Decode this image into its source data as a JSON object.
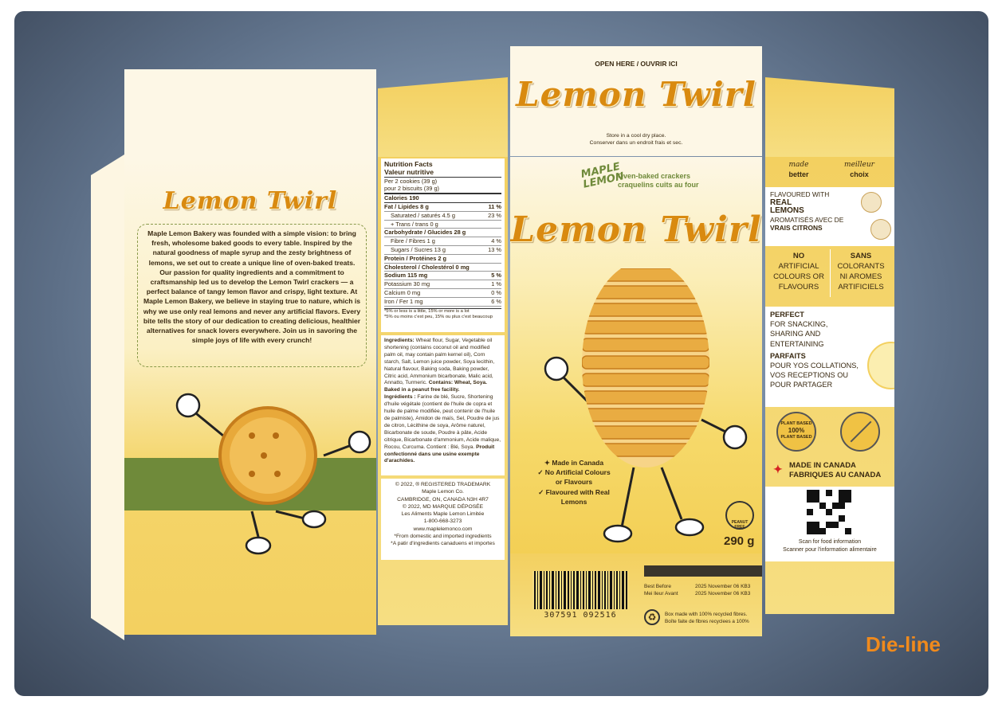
{
  "product_name": "Lemon Twirl",
  "back_panel": {
    "story": "Maple Lemon Bakery was founded with a simple vision: to bring fresh, wholesome baked goods to every table. Inspired by the natural goodness of maple syrup and the zesty brightness of lemons, we set out to create a unique line of oven-baked treats. Our passion for quality ingredients and a commitment to craftsmanship led us to develop the Lemon Twirl crackers — a perfect balance of tangy lemon flavor and crispy, light texture. At Maple Lemon Bakery, we believe in staying true to nature, which is why we use only real lemons and never any artificial flavors. Every bite tells the story of our dedication to creating delicious, healthier alternatives for snack lovers everywhere. Join us in savoring the simple joys of life with every crunch!"
  },
  "nutrition": {
    "title_en": "Nutrition Facts",
    "title_fr": "Valeur nutritive",
    "serving_en": "Per 2 cookies (39 g)",
    "serving_fr": "pour 2 biscuits (39 g)",
    "calories": "Calories 190",
    "rows": [
      {
        "label": "Fat / Lipides 8 g",
        "dv": "11 %",
        "bold": true
      },
      {
        "label": "Saturated / saturés 4.5 g",
        "dv": "23 %",
        "indent": true
      },
      {
        "label": "+ Trans / trans 0 g",
        "dv": "",
        "indent": true
      },
      {
        "label": "Carbohydrate / Glucides 28 g",
        "dv": "",
        "bold": true
      },
      {
        "label": "Fibre / Fibres 1 g",
        "dv": "4 %",
        "indent": true
      },
      {
        "label": "Sugars / Sucres 13 g",
        "dv": "13 %",
        "indent": true
      },
      {
        "label": "Protein / Protéines 2 g",
        "dv": "",
        "bold": true
      },
      {
        "label": "Cholesterol / Cholestérol 0 mg",
        "dv": "",
        "bold": true
      },
      {
        "label": "Sodium 115 mg",
        "dv": "5 %",
        "bold": true
      },
      {
        "label": "Potassium 30 mg",
        "dv": "1 %"
      },
      {
        "label": "Calcium 0 mg",
        "dv": "0 %"
      },
      {
        "label": "Iron / Fer 1 mg",
        "dv": "6 %"
      }
    ],
    "footnote_en": "*5% or less is a little, 15% or more is a lot",
    "footnote_fr": "*5% ou moins c'est peu, 15% ou plus c'est beaucoup"
  },
  "ingredients": {
    "en_label": "Ingredients:",
    "en": "Wheat flour, Sugar, Vegetable oil shortening (contains coconut oil and modified palm oil, may contain palm kernel oil), Corn starch, Salt, Lemon juice powder, Soya lecithin, Natural flavour, Baking soda, Baking powder, Citric acid, Ammonium bicarbonate, Malic acid, Annatto, Turmeric.",
    "en_contains": "Contains: Wheat, Soya.",
    "peanut_free": "Baked in a peanut free facility.",
    "fr_label": "Ingrédients :",
    "fr": "Farine de blé, Sucre, Shortening d'huile végétale (contient de l'huile de copra et huile de palme modifiée, peut contenir de l'huile de palmiste), Amidon de maïs, Sel, Poudre de jus de citron, Lécithine de soya, Arôme naturel, Bicarbonate de soude, Poudre à pâte, Acide citrique, Bicarbonate d'ammonium, Acide malique, Rocou, Curcuma.",
    "fr_contains": "Contient : Blé, Soya.",
    "fr_peanut": "Produit confectionné dans une usine exempte d'arachides."
  },
  "company": {
    "lines": [
      "© 2022, ® REGISTERED TRADEMARK",
      "Maple Lemon Co.",
      "CAMBRIDGE, ON, CANADA N3H 4R7",
      "© 2022, MD MARQUE DÉPOSÉE",
      "Les Aliments Maple Lemon Limitée",
      "1-800-668-3273",
      "www.maplelemonco.com",
      "*From domestic and imported ingredients",
      "*A patir d'ingredients canaduens et importes"
    ]
  },
  "front_top": {
    "open_here": "OPEN HERE / OUVRIR ICI",
    "storage_en": "Store in a cool dry place.",
    "storage_fr": "Conserver dans un endroit frais et sec."
  },
  "front": {
    "brand_line1": "MAPLE",
    "brand_line2": "LEMON",
    "tagline_en": "Oven-baked crackers",
    "tagline_fr": "craquelins cuits au four",
    "claims": [
      "Made in Canada",
      "No Artificial Colours",
      "or Flavours",
      "Flavoured with Real",
      "Lemons"
    ],
    "peanut_badge": "PEANUT FREE",
    "weight": "290 g"
  },
  "bottom_flap": {
    "best_before_en": "Best Before",
    "best_before_fr": "Mei lleur Avant",
    "date1": "2025 November 06 KB3",
    "date2": "2025 November 06 KB3",
    "barcode_number": "307591 092516",
    "recycle_en": "Box made with 100% recycled fibres.",
    "recycle_fr": "Boîte faite de fibres recyclees a 100%"
  },
  "side": {
    "made_en": "made",
    "better_en": "better",
    "made_fr": "meilleur",
    "better_fr": "choix",
    "flavoured_with": "FLAVOURED WITH",
    "real_lemons_1": "REAL",
    "real_lemons_2": "LEMONS",
    "aromatises": "AROMATISÉS AVEC DE",
    "vrais_citrons": "VRAIS CITRONS",
    "no_art_1": "NO",
    "no_art_2": "ARTIFICIAL",
    "no_art_3": "COLOURS OR",
    "no_art_4": "FLAVOURS",
    "sans_1": "SANS",
    "sans_2": "COLORANTS",
    "sans_3": "NI AROMES",
    "sans_4": "ARTIFICIELS",
    "perfect": "PERFECT",
    "perfect_lines": [
      "FOR SNACKING,",
      "SHARING AND",
      "ENTERTAINING"
    ],
    "parfaits": "PARFAITS",
    "parfaits_lines": [
      "POUR YOS COLLATIONS,",
      "VOS RECEPTIONS OU",
      "POUR PARTAGER"
    ],
    "plant_based_1": "PLANT BASED",
    "plant_based_2": "100%",
    "plant_based_3": "PLANT BASED",
    "made_in_canada": "MADE IN CANADA",
    "fabriques": "FABRIQUES AU CANADA",
    "scan_en": "Scan for food information",
    "scan_fr": "Scanner pour l'information alimentaire"
  },
  "dieline_label": "Die-line",
  "colors": {
    "accent": "#f08a1c",
    "yellow": "#f3d060",
    "green": "#6f8a3a",
    "cream": "#fdf7e6"
  }
}
